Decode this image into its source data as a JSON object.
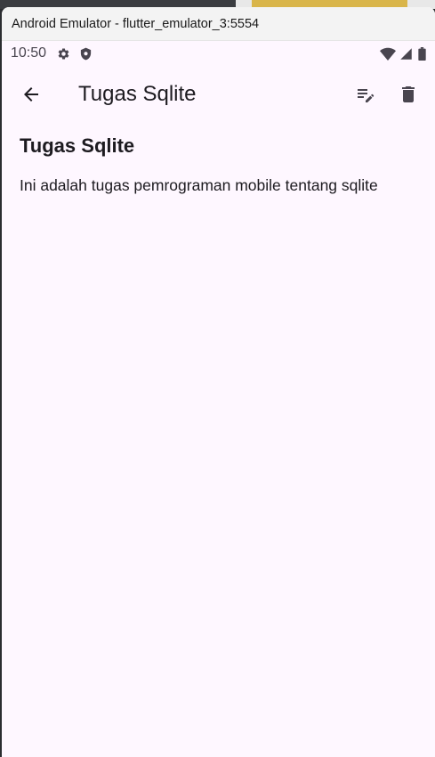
{
  "window": {
    "title": "Android Emulator - flutter_emulator_3:5554"
  },
  "statusbar": {
    "time": "10:50",
    "left_icons": [
      "settings-gear-icon",
      "shield-icon"
    ],
    "right_icons": [
      "wifi-icon",
      "signal-icon",
      "battery-icon"
    ]
  },
  "appbar": {
    "title": "Tugas Sqlite",
    "back_icon": "arrow-back-icon",
    "actions": [
      "edit-note-icon",
      "delete-icon"
    ]
  },
  "note": {
    "title": "Tugas Sqlite",
    "body": "Ini adalah tugas pemrograman mobile tentang sqlite"
  },
  "colors": {
    "background": "#fef7ff",
    "text": "#1d1b20",
    "icon": "#49454f"
  }
}
